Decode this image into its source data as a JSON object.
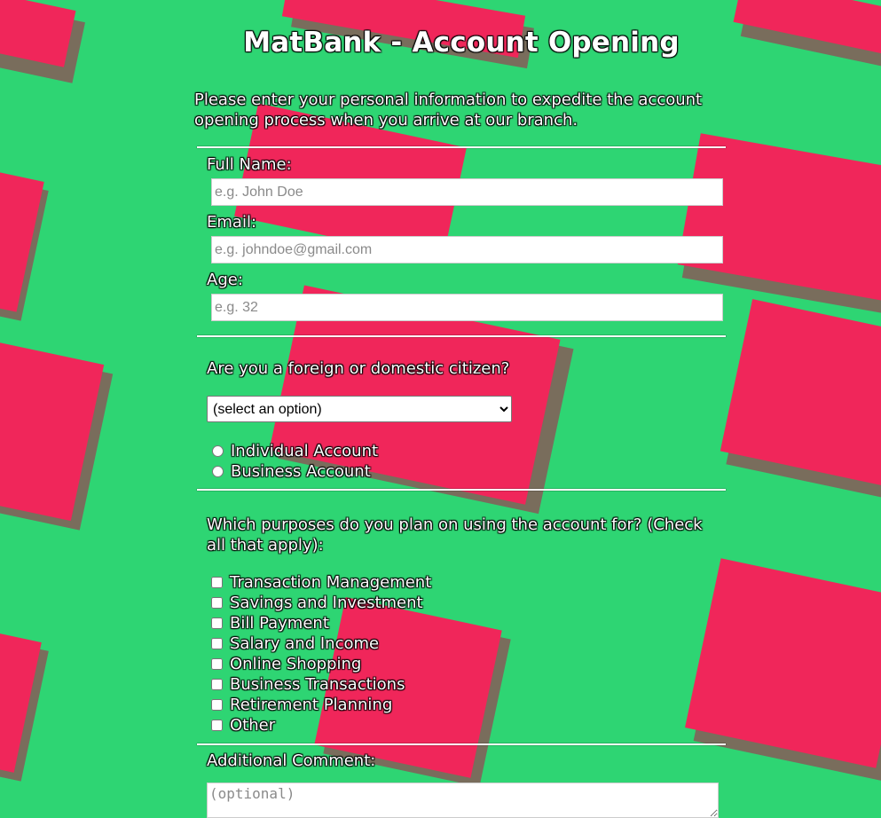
{
  "page": {
    "title": "MatBank - Account Opening",
    "intro": "Please enter your personal information to expedite the account opening process when you arrive at our branch."
  },
  "personal": {
    "full_name_label": "Full Name:",
    "full_name_placeholder": "e.g. John Doe",
    "email_label": "Email:",
    "email_placeholder": "e.g. johndoe@gmail.com",
    "age_label": "Age:",
    "age_placeholder": "e.g. 32"
  },
  "citizenship": {
    "question": "Are you a foreign or domestic citizen?",
    "selected_option": "(select an option)"
  },
  "account_type": {
    "options": [
      "Individual Account",
      "Business Account"
    ]
  },
  "purposes": {
    "question": "Which purposes do you plan on using the account for? (Check all that apply):",
    "options": [
      "Transaction Management",
      "Savings and Investment",
      "Bill Payment",
      "Salary and Income",
      "Online Shopping",
      "Business Transactions",
      "Retirement Planning",
      "Other"
    ]
  },
  "comment": {
    "label": "Additional Comment:",
    "placeholder": "(optional)"
  },
  "colors": {
    "background": "#2ed573",
    "accent_pink": "#f0265a",
    "text": "#ffffff"
  }
}
